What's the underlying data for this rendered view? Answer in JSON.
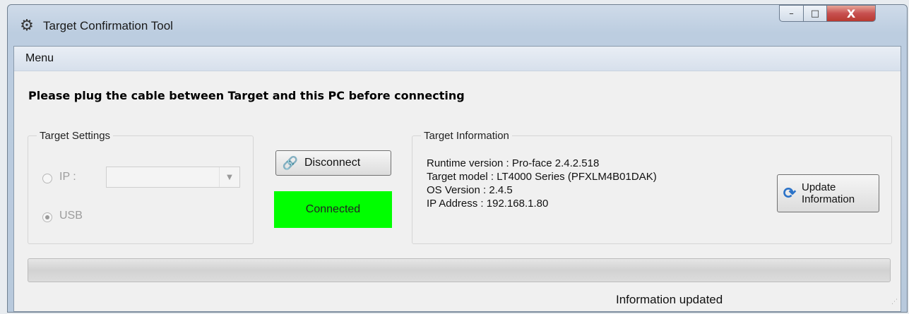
{
  "window": {
    "title": "Target Confirmation Tool",
    "icon": "gears-icon",
    "controls": {
      "minimize": "–",
      "maximize": "□",
      "close": "X"
    }
  },
  "menu": {
    "items": [
      "Menu"
    ]
  },
  "instruction": "Please plug the cable between Target and this PC before connecting",
  "target_settings": {
    "legend": "Target Settings",
    "ip_label": "IP :",
    "usb_label": "USB",
    "ip_value": "",
    "selected": "USB",
    "enabled": false
  },
  "connection": {
    "button_label": "Disconnect",
    "button_icon": "link-icon",
    "status_label": "Connected",
    "status_color": "#00ff00"
  },
  "target_information": {
    "legend": "Target Information",
    "runtime_version": "Runtime version : Pro-face 2.4.2.518",
    "target_model": "Target model : LT4000 Series (PFXLM4B01DAK)",
    "os_version": "OS Version : 2.4.5",
    "ip_address": "IP Address : 192.168.1.80",
    "update_button": {
      "line1": "Update",
      "line2": "Information",
      "icon": "refresh-icon"
    }
  },
  "progress": {
    "value": 0
  },
  "status_bar": {
    "text": "Information updated"
  }
}
